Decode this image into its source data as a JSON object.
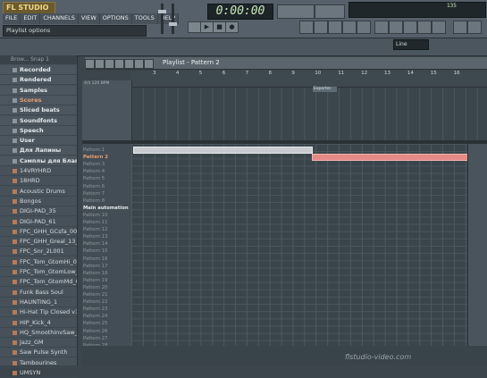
{
  "app": {
    "logo": "FL STUDIO"
  },
  "menu": [
    "FILE",
    "EDIT",
    "CHANNELS",
    "VIEW",
    "OPTIONS",
    "TOOLS",
    "HELP"
  ],
  "hint_bar": "Playlist options",
  "transport": {
    "time": "0:00:00"
  },
  "monitor": {
    "cpu": "135"
  },
  "pattern_selector": {
    "value": "Line"
  },
  "browser": {
    "header": "Brow... Snap 1",
    "items": [
      {
        "label": "Recorded",
        "type": "folder"
      },
      {
        "label": "Rendered",
        "type": "folder"
      },
      {
        "label": "Samples",
        "type": "folder"
      },
      {
        "label": "Scores",
        "type": "folder",
        "selected": true
      },
      {
        "label": "Sliced beats",
        "type": "folder"
      },
      {
        "label": "Soundfonts",
        "type": "folder"
      },
      {
        "label": "Speech",
        "type": "folder"
      },
      {
        "label": "User",
        "type": "folder"
      },
      {
        "label": "Для Лапины",
        "type": "folder"
      },
      {
        "label": "Сэмплы для Благов",
        "type": "folder"
      },
      {
        "label": "14VRYHRD",
        "type": "file"
      },
      {
        "label": "18HRD",
        "type": "file"
      },
      {
        "label": "Acoustic Drums",
        "type": "file"
      },
      {
        "label": "Bongos",
        "type": "file"
      },
      {
        "label": "DIGI-PAD_35",
        "type": "file"
      },
      {
        "label": "DIGI-PAD_61",
        "type": "file"
      },
      {
        "label": "FPC_GHH_GCsfa_004",
        "type": "file"
      },
      {
        "label": "FPC_GHH_Greal_13_",
        "type": "file"
      },
      {
        "label": "FPC_Snr_2L001",
        "type": "file"
      },
      {
        "label": "FPC_Tom_GtomHi_0",
        "type": "file"
      },
      {
        "label": "FPC_Tom_GtomLow_",
        "type": "file"
      },
      {
        "label": "FPC_Tom_GtomMd_0",
        "type": "file"
      },
      {
        "label": "Funk Bass Soul",
        "type": "file"
      },
      {
        "label": "HAUNTING_1",
        "type": "file"
      },
      {
        "label": "Hi-Hat Tip Closed v1-",
        "type": "file"
      },
      {
        "label": "HIP_Kick_4",
        "type": "file"
      },
      {
        "label": "HQ_SmoothinvSaw_",
        "type": "file"
      },
      {
        "label": "Jazz_GM",
        "type": "file"
      },
      {
        "label": "Saw Pulse Synth",
        "type": "file"
      },
      {
        "label": "Tambourines",
        "type": "file"
      },
      {
        "label": "UMSYN",
        "type": "file"
      }
    ]
  },
  "playlist": {
    "title": "Playlist - Pattern 2",
    "ruler_ticks": [
      "3",
      "4",
      "5",
      "6",
      "7",
      "8",
      "9",
      "10",
      "11",
      "12",
      "13",
      "14",
      "15",
      "16"
    ],
    "info_text": "4/4 120 BPM",
    "marker": "Exporter",
    "tracks": [
      "Pattern 1",
      "Pattern 2",
      "Pattern 3",
      "Pattern 4",
      "Pattern 5",
      "Pattern 6",
      "Pattern 7",
      "Pattern 8",
      "Main automation",
      "Pattern 10",
      "Pattern 11",
      "Pattern 12",
      "Pattern 13",
      "Pattern 14",
      "Pattern 15",
      "Pattern 16",
      "Pattern 17",
      "Pattern 18",
      "Pattern 19",
      "Pattern 20",
      "Pattern 21",
      "Pattern 22",
      "Pattern 23",
      "Pattern 24",
      "Pattern 25",
      "Pattern 26",
      "Pattern 27",
      "Pattern 28"
    ]
  },
  "watermark": "flstudio-video.com"
}
